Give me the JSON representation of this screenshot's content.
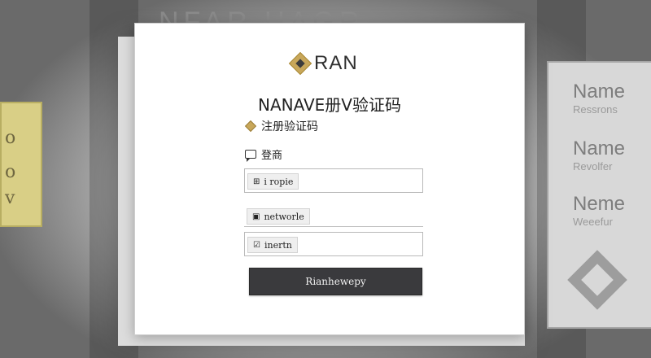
{
  "background": {
    "top_text": "NFAR UAGR",
    "right_card": {
      "rows": [
        {
          "word": "Name",
          "sub": "Ressrons"
        },
        {
          "word": "Name",
          "sub": "Revolfer"
        },
        {
          "word": "Neme",
          "sub": "Weeefur"
        }
      ]
    },
    "left_panel_glyphs": [
      "o",
      "o",
      "v"
    ]
  },
  "brand": {
    "name": "RAN",
    "accent_color": "#c8a75a"
  },
  "form": {
    "title": "NANAVE册V验证码",
    "subtitle": "注册验证码",
    "section_label": "登商",
    "fields": [
      {
        "icon": "⊞",
        "text": "i ropie"
      },
      {
        "icon": "▣",
        "text": "networle"
      },
      {
        "icon": "☑",
        "text": "inertn"
      }
    ],
    "submit_label": "Rianhewepy"
  }
}
